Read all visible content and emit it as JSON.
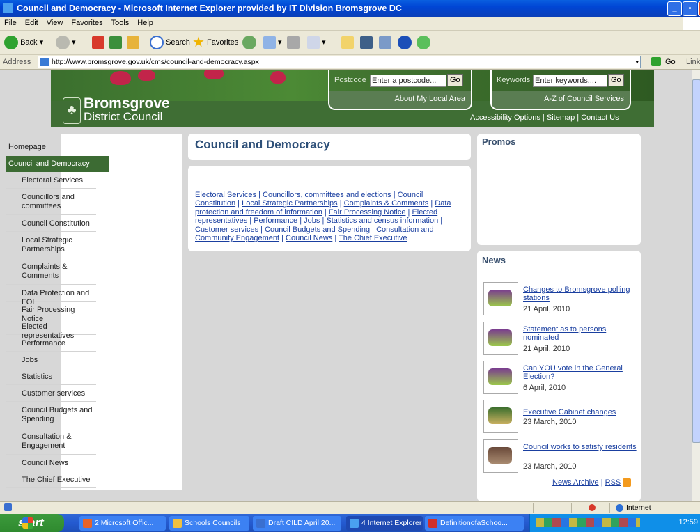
{
  "window": {
    "title": "Council and Democracy - Microsoft Internet Explorer provided by IT Division Bromsgrove DC"
  },
  "menu": [
    "File",
    "Edit",
    "View",
    "Favorites",
    "Tools",
    "Help"
  ],
  "toolbar": {
    "back_label": "Back",
    "search_label": "Search",
    "favorites_label": "Favorites"
  },
  "address": {
    "label": "Address",
    "url": "http://www.bromsgrove.gov.uk/cms/council-and-democracy.aspx",
    "go_label": "Go",
    "links_label": "Links"
  },
  "site": {
    "name": "Bromsgrove",
    "subname": "District Council",
    "postcode_label": "Postcode",
    "postcode_placeholder": "Enter a postcode...",
    "postcode_go": "Go",
    "about_local_area": "About My Local Area",
    "keywords_label": "Keywords",
    "keywords_placeholder": "Enter keywords....",
    "keywords_go": "Go",
    "az_services": "A-Z of Council Services",
    "utility_links": [
      "Accessibility Options",
      "Sitemap",
      "Contact Us"
    ]
  },
  "nav": {
    "items": [
      {
        "label": "Homepage",
        "level": "home"
      },
      {
        "label": "Council and Democracy",
        "level": "active"
      },
      {
        "label": "Electoral Services",
        "level": "sub"
      },
      {
        "label": "Councillors and committees",
        "level": "sub"
      },
      {
        "label": "Council Constitution",
        "level": "sub"
      },
      {
        "label": "Local Strategic Partnerships",
        "level": "sub"
      },
      {
        "label": "Complaints & Comments",
        "level": "sub"
      },
      {
        "label": "Data Protection and FOI",
        "level": "sub"
      },
      {
        "label": "Fair Processing Notice",
        "level": "sub"
      },
      {
        "label": "Elected representatives",
        "level": "sub"
      },
      {
        "label": "Performance",
        "level": "sub"
      },
      {
        "label": "Jobs",
        "level": "sub"
      },
      {
        "label": "Statistics",
        "level": "sub"
      },
      {
        "label": "Customer services",
        "level": "sub"
      },
      {
        "label": "Council Budgets and Spending",
        "level": "sub"
      },
      {
        "label": "Consultation & Engagement",
        "level": "sub"
      },
      {
        "label": "Council News",
        "level": "sub"
      },
      {
        "label": "The Chief Executive",
        "level": "sub"
      }
    ]
  },
  "main": {
    "title": "Council and Democracy",
    "links": [
      "Electoral Services",
      "Councillors, committees and elections",
      "Council Constitution",
      "Local Strategic Partnerships",
      "Complaints & Comments",
      "Data protection and freedom of information",
      "Fair Processing Notice",
      "Elected representatives",
      "Performance",
      "Jobs",
      "Statistics and census information",
      "Customer services",
      "Council Budgets and Spending",
      "Consultation and Community Engagement",
      "Council News",
      "The Chief Executive"
    ],
    "link_separator": " | "
  },
  "right": {
    "promos_title": "Promos",
    "news_title": "News",
    "news": [
      {
        "title": "Changes to Bromsgrove polling stations",
        "date": "21 April, 2010",
        "thumb": "election-poster-thumb"
      },
      {
        "title": "Statement as to persons nominated",
        "date": "21 April, 2010",
        "thumb": "election-poster-thumb"
      },
      {
        "title": "Can YOU vote in the General Election?",
        "date": "6 April, 2010",
        "thumb": "election-poster-thumb"
      },
      {
        "title": "Executive Cabinet changes",
        "date": "23 March, 2010",
        "thumb": "council-logo-thumb"
      },
      {
        "title": "Council works to satisfy residents",
        "date": "23 March, 2010",
        "thumb": "residents-photo-thumb"
      }
    ],
    "news_archive": "News Archive",
    "rss": "RSS"
  },
  "status": {
    "zone": "Internet"
  },
  "taskbar": {
    "start": "start",
    "tasks": [
      {
        "label": "2 Microsoft Offic...",
        "color": "#e8632a"
      },
      {
        "label": "Schools Councils",
        "color": "#f0c040"
      },
      {
        "label": "Draft CILD April 20...",
        "color": "#3a6fd0"
      },
      {
        "label": "4 Internet Explorer",
        "color": "#4aa0f0"
      },
      {
        "label": "DefinitionofaSchoo...",
        "color": "#d0302a"
      }
    ],
    "clock": "12:59"
  }
}
